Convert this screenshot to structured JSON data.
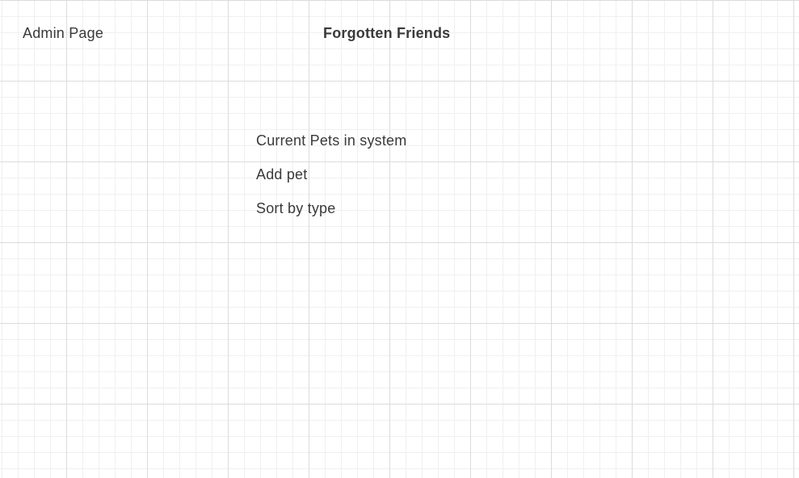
{
  "header": {
    "admin_label": "Admin Page",
    "site_title": "Forgotten Friends"
  },
  "menu": {
    "items": [
      {
        "label": "Current Pets in system"
      },
      {
        "label": "Add pet"
      },
      {
        "label": "Sort by type"
      }
    ]
  }
}
